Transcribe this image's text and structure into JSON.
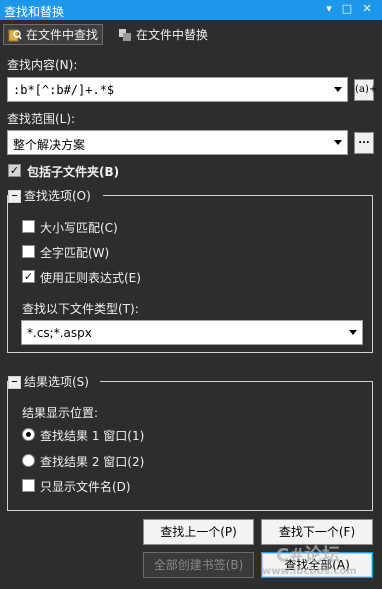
{
  "window": {
    "title": "查找和替换"
  },
  "tabs": [
    {
      "label": "在文件中查找",
      "active": true
    },
    {
      "label": "在文件中替换",
      "active": false
    }
  ],
  "find_what": {
    "label": "查找内容(N):",
    "value": ":b*[^:b#/]+.*$",
    "builder_label": "(a)+"
  },
  "look_in": {
    "label": "查找范围(L):",
    "value": "整个解决方案",
    "browse_label": "..."
  },
  "include_subfolders": {
    "label": "包括子文件夹(B)",
    "checked": true
  },
  "find_options": {
    "header": "查找选项(O)",
    "match_case": {
      "label": "大小写匹配(C)",
      "checked": false
    },
    "match_whole_word": {
      "label": "全字匹配(W)",
      "checked": false
    },
    "use_regex": {
      "label": "使用正则表达式(E)",
      "checked": true
    },
    "file_types_label": "查找以下文件类型(T):",
    "file_types_value": "*.cs;*.aspx"
  },
  "result_options": {
    "header": "结果选项(S)",
    "location_label": "结果显示位置:",
    "window1": {
      "label": "查找结果 1 窗口(1)",
      "selected": true
    },
    "window2": {
      "label": "查找结果 2 窗口(2)",
      "selected": false
    },
    "file_names_only": {
      "label": "只显示文件名(D)",
      "checked": false
    }
  },
  "buttons": {
    "find_prev": "查找上一个(P)",
    "find_next": "查找下一个(F)",
    "bookmark_all": "全部创建书签(B)",
    "find_all": "查找全部(A)"
  },
  "watermark": {
    "line1": "C#论坛",
    "line2": "www.ibcbbs.com"
  },
  "colors": {
    "titlebar": "#1c97ea",
    "background": "#2d2d30"
  }
}
